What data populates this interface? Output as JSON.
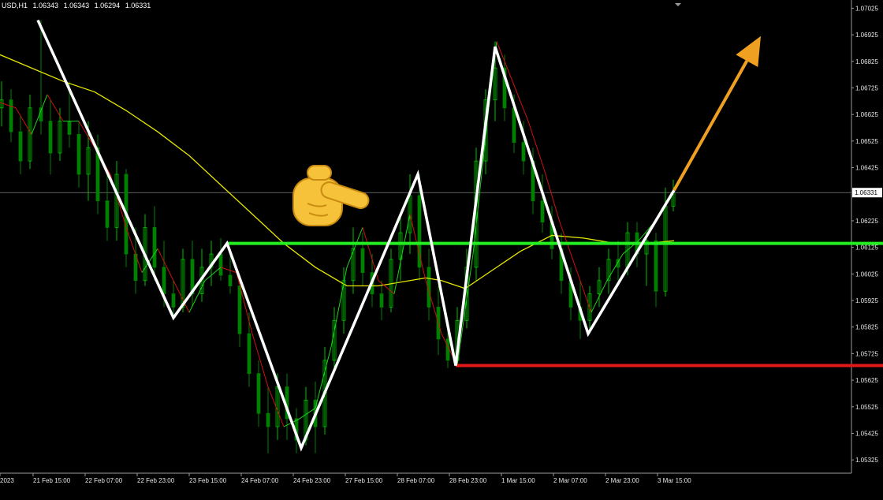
{
  "header": {
    "symbol": "USD,H1",
    "open": "1.06343",
    "high": "1.06343",
    "low": "1.06294",
    "close": "1.06331"
  },
  "colors": {
    "background": "#000000",
    "axis_text": "#e6e6e6",
    "candle_up": "#00c000",
    "candle_down": "#008000",
    "ma_slow": "#e6e600",
    "ma_fast_up": "#20d020",
    "ma_fast_down": "#d01010",
    "zigzag": "#ffffff",
    "support_line": "#22ee22",
    "low_line": "#e01818",
    "arrow": "#f0a020",
    "price_line": "#808080"
  },
  "chart_data": {
    "type": "line",
    "title": "",
    "xlabel": "",
    "ylabel": "",
    "ylim": [
      1.05275,
      1.0705
    ],
    "current_price": 1.06331,
    "y_ticks": [
      "1.07025",
      "1.06925",
      "1.06825",
      "1.06725",
      "1.06625",
      "1.06525",
      "1.06425",
      "1.06331",
      "1.06225",
      "1.06125",
      "1.06025",
      "1.05925",
      "1.05825",
      "1.05725",
      "1.05625",
      "1.05525",
      "1.05425",
      "1.05325"
    ],
    "x_ticks": [
      "2023",
      "21 Feb 15:00",
      "22 Feb 07:00",
      "22 Feb 23:00",
      "23 Feb 15:00",
      "24 Feb 07:00",
      "24 Feb 23:00",
      "27 Feb 15:00",
      "28 Feb 07:00",
      "28 Feb 23:00",
      "1 Mar 15:00",
      "2 Mar 07:00",
      "2 Mar 23:00",
      "3 Mar 15:00"
    ],
    "x_tick_index": [
      0,
      42,
      108,
      174,
      240,
      306,
      372,
      438,
      504,
      570,
      636,
      702,
      768,
      834
    ],
    "x_range": [
      0,
      1080
    ],
    "zigzag": {
      "x": [
        48,
        220,
        288,
        382,
        530,
        578,
        628,
        746,
        855
      ],
      "y": [
        1.0698,
        1.0586,
        1.0614,
        1.0537,
        1.064,
        1.0568,
        1.0688,
        1.058,
        1.0634
      ]
    },
    "ma_slow": {
      "x": [
        0,
        40,
        80,
        120,
        160,
        200,
        240,
        280,
        320,
        360,
        400,
        440,
        480,
        520,
        540,
        560,
        590,
        620,
        660,
        700,
        740,
        780,
        820,
        855
      ],
      "y": [
        1.0685,
        1.068,
        1.0675,
        1.0671,
        1.0664,
        1.0656,
        1.0647,
        1.0636,
        1.0625,
        1.0614,
        1.0605,
        1.0598,
        1.0598,
        1.06,
        1.0601,
        1.06,
        1.0597,
        1.0603,
        1.0611,
        1.0617,
        1.0616,
        1.0614,
        1.0614,
        1.0615
      ]
    },
    "ma_fast": {
      "x": [
        0,
        20,
        40,
        60,
        80,
        100,
        120,
        140,
        160,
        180,
        200,
        220,
        240,
        260,
        280,
        300,
        320,
        340,
        360,
        380,
        400,
        420,
        440,
        460,
        480,
        500,
        520,
        540,
        560,
        580,
        600,
        620,
        630,
        650,
        670,
        690,
        710,
        730,
        750,
        770,
        790,
        810,
        830,
        855
      ],
      "y": [
        1.0667,
        1.0665,
        1.0655,
        1.067,
        1.066,
        1.066,
        1.065,
        1.064,
        1.062,
        1.0603,
        1.0612,
        1.06,
        1.0588,
        1.06,
        1.0605,
        1.0603,
        1.058,
        1.056,
        1.0545,
        1.0548,
        1.0552,
        1.0575,
        1.0605,
        1.062,
        1.06,
        1.0595,
        1.0625,
        1.06,
        1.058,
        1.0568,
        1.061,
        1.0665,
        1.069,
        1.0675,
        1.066,
        1.0642,
        1.0622,
        1.0605,
        1.0588,
        1.06,
        1.061,
        1.0615,
        1.0622,
        1.0634
      ]
    },
    "candles": [
      [
        0,
        1.0665,
        1.0675,
        1.0658,
        1.0668
      ],
      [
        12,
        1.0668,
        1.0672,
        1.0652,
        1.0656
      ],
      [
        24,
        1.0656,
        1.0662,
        1.064,
        1.0645
      ],
      [
        36,
        1.0645,
        1.067,
        1.0642,
        1.0665
      ],
      [
        50,
        1.0665,
        1.0698,
        1.0655,
        1.066
      ],
      [
        62,
        1.066,
        1.0668,
        1.064,
        1.0648
      ],
      [
        74,
        1.0648,
        1.0665,
        1.0645,
        1.066
      ],
      [
        86,
        1.066,
        1.0675,
        1.065,
        1.0655
      ],
      [
        98,
        1.0655,
        1.066,
        1.0635,
        1.064
      ],
      [
        110,
        1.064,
        1.066,
        1.063,
        1.065
      ],
      [
        122,
        1.065,
        1.0655,
        1.0625,
        1.063
      ],
      [
        134,
        1.063,
        1.064,
        1.0615,
        1.062
      ],
      [
        146,
        1.062,
        1.0645,
        1.0615,
        1.064
      ],
      [
        158,
        1.064,
        1.0642,
        1.0605,
        1.061
      ],
      [
        170,
        1.061,
        1.062,
        1.0595,
        1.06
      ],
      [
        182,
        1.06,
        1.0625,
        1.0598,
        1.062
      ],
      [
        194,
        1.062,
        1.0628,
        1.06,
        1.0605
      ],
      [
        206,
        1.0605,
        1.0615,
        1.059,
        1.0595
      ],
      [
        218,
        1.0595,
        1.06,
        1.0585,
        1.059
      ],
      [
        230,
        1.059,
        1.0612,
        1.0588,
        1.0608
      ],
      [
        242,
        1.0608,
        1.0615,
        1.059,
        1.0595
      ],
      [
        254,
        1.0595,
        1.0612,
        1.0592,
        1.0605
      ],
      [
        266,
        1.0605,
        1.0615,
        1.0598,
        1.061
      ],
      [
        278,
        1.061,
        1.0616,
        1.06,
        1.0602
      ],
      [
        290,
        1.0602,
        1.0612,
        1.0595,
        1.0598
      ],
      [
        302,
        1.0598,
        1.06,
        1.0575,
        1.058
      ],
      [
        314,
        1.058,
        1.0588,
        1.056,
        1.0565
      ],
      [
        326,
        1.0565,
        1.057,
        1.0545,
        1.055
      ],
      [
        338,
        1.055,
        1.056,
        1.0535,
        1.0545
      ],
      [
        350,
        1.0545,
        1.0565,
        1.054,
        1.056
      ],
      [
        362,
        1.056,
        1.0565,
        1.054,
        1.0548
      ],
      [
        374,
        1.0548,
        1.0552,
        1.0535,
        1.054
      ],
      [
        386,
        1.054,
        1.056,
        1.0538,
        1.0555
      ],
      [
        398,
        1.0555,
        1.0562,
        1.0535,
        1.0545
      ],
      [
        410,
        1.0545,
        1.0575,
        1.0542,
        1.057
      ],
      [
        422,
        1.057,
        1.059,
        1.0565,
        1.0585
      ],
      [
        434,
        1.0585,
        1.0605,
        1.058,
        1.06
      ],
      [
        446,
        1.06,
        1.062,
        1.0595,
        1.0612
      ],
      [
        458,
        1.0612,
        1.0618,
        1.0598,
        1.0603
      ],
      [
        470,
        1.0603,
        1.061,
        1.059,
        1.0595
      ],
      [
        482,
        1.0595,
        1.06,
        1.0585,
        1.059
      ],
      [
        494,
        1.059,
        1.0612,
        1.0588,
        1.0608
      ],
      [
        506,
        1.0608,
        1.0625,
        1.06,
        1.0618
      ],
      [
        518,
        1.0618,
        1.064,
        1.061,
        1.0632
      ],
      [
        530,
        1.0632,
        1.064,
        1.06,
        1.0605
      ],
      [
        542,
        1.0605,
        1.0612,
        1.0585,
        1.059
      ],
      [
        554,
        1.059,
        1.0598,
        1.0572,
        1.0578
      ],
      [
        566,
        1.0578,
        1.0584,
        1.0567,
        1.057
      ],
      [
        578,
        1.057,
        1.059,
        1.0568,
        1.0585
      ],
      [
        590,
        1.0585,
        1.0612,
        1.0582,
        1.0605
      ],
      [
        602,
        1.0605,
        1.065,
        1.06,
        1.0645
      ],
      [
        614,
        1.0645,
        1.0672,
        1.064,
        1.0668
      ],
      [
        626,
        1.0668,
        1.069,
        1.066,
        1.068
      ],
      [
        638,
        1.068,
        1.0685,
        1.066,
        1.0665
      ],
      [
        650,
        1.0665,
        1.067,
        1.0648,
        1.0652
      ],
      [
        662,
        1.0652,
        1.066,
        1.064,
        1.0645
      ],
      [
        674,
        1.0645,
        1.065,
        1.0625,
        1.063
      ],
      [
        686,
        1.063,
        1.064,
        1.0618,
        1.0622
      ],
      [
        698,
        1.0622,
        1.0628,
        1.0608,
        1.0612
      ],
      [
        710,
        1.0612,
        1.0618,
        1.0595,
        1.06
      ],
      [
        722,
        1.06,
        1.0605,
        1.0585,
        1.059
      ],
      [
        734,
        1.059,
        1.06,
        1.0578,
        1.0585
      ],
      [
        746,
        1.0585,
        1.0598,
        1.058,
        1.0595
      ],
      [
        758,
        1.0595,
        1.0605,
        1.059,
        1.06
      ],
      [
        770,
        1.06,
        1.0612,
        1.0595,
        1.0608
      ],
      [
        782,
        1.0608,
        1.0615,
        1.06,
        1.0605
      ],
      [
        794,
        1.0605,
        1.0622,
        1.0602,
        1.0618
      ],
      [
        806,
        1.0618,
        1.0622,
        1.0605,
        1.061
      ],
      [
        818,
        1.061,
        1.0618,
        1.0598,
        1.0615
      ],
      [
        830,
        1.0615,
        1.0618,
        1.059,
        1.0596
      ],
      [
        842,
        1.0596,
        1.0635,
        1.0594,
        1.0628
      ],
      [
        852,
        1.0628,
        1.0638,
        1.0626,
        1.0633
      ]
    ],
    "support_level": {
      "x_start": 288,
      "value": 1.0614
    },
    "low_level": {
      "x_start": 578,
      "value": 1.0568
    },
    "projection_arrow": {
      "x_from": 855,
      "y_from": 1.0634,
      "x_to": 965,
      "y_to": 1.0692
    }
  }
}
